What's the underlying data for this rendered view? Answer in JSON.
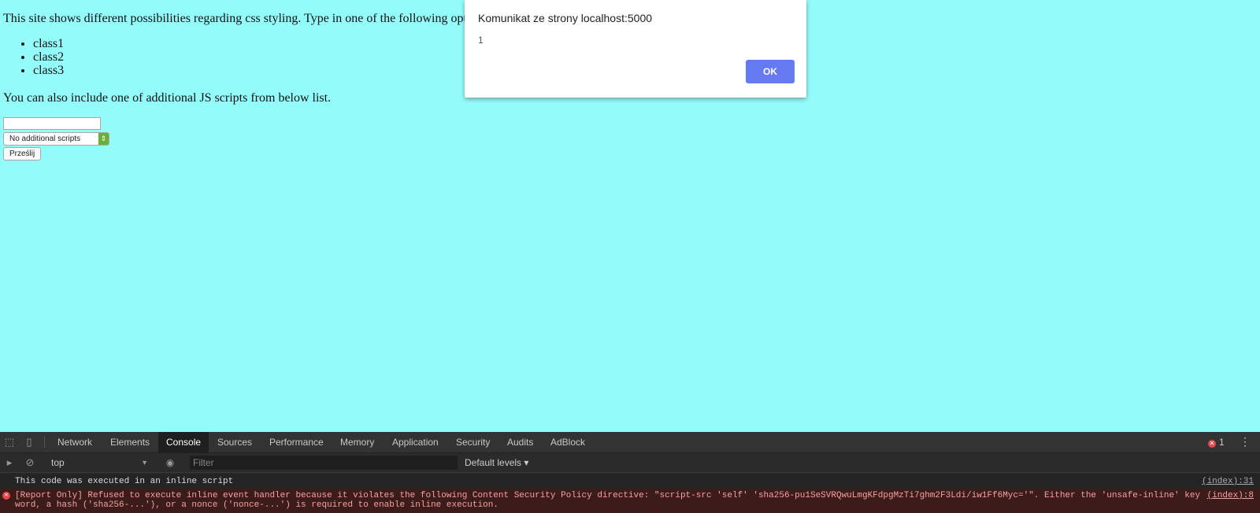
{
  "page": {
    "intro_text": "This site shows different possibilities regarding css styling. Type in one of the following options",
    "classes": [
      "class1",
      "class2",
      "class3"
    ],
    "also_text": "You can also include one of additional JS scripts from below list.",
    "text_input_value": "",
    "select_value": "No additional scripts",
    "submit_label": "Prześlij",
    "background_color": "#94fbfb"
  },
  "dialog": {
    "title": "Komunikat ze strony localhost:5000",
    "message": "1",
    "ok_label": "OK",
    "ok_color": "#6579f0"
  },
  "devtools": {
    "tabs": [
      "Network",
      "Elements",
      "Console",
      "Sources",
      "Performance",
      "Memory",
      "Application",
      "Security",
      "Audits",
      "AdBlock"
    ],
    "active_tab": "Console",
    "error_count": "1",
    "context": "top",
    "filter_placeholder": "Filter",
    "levels": "Default levels",
    "log": {
      "message": "This code was executed in an inline script",
      "source": "(index):31"
    },
    "error": {
      "message": "[Report Only] Refused to execute inline event handler because it violates the following Content Security Policy directive: \"script-src 'self' 'sha256-pu1SeSVRQwuLmgKFdpgMzTi7ghm2F3Ldi/iw1Ff6Myc='\". Either the 'unsafe-inline' keyword, a hash ('sha256-...'), or a nonce ('nonce-...') is required to enable inline execution.",
      "source": "(index):8"
    },
    "icons": [
      "inspect-icon",
      "device-toggle-icon",
      "sidebar-toggle-icon",
      "clear-console-icon",
      "eye-icon",
      "more-icon",
      "error-icon"
    ]
  }
}
